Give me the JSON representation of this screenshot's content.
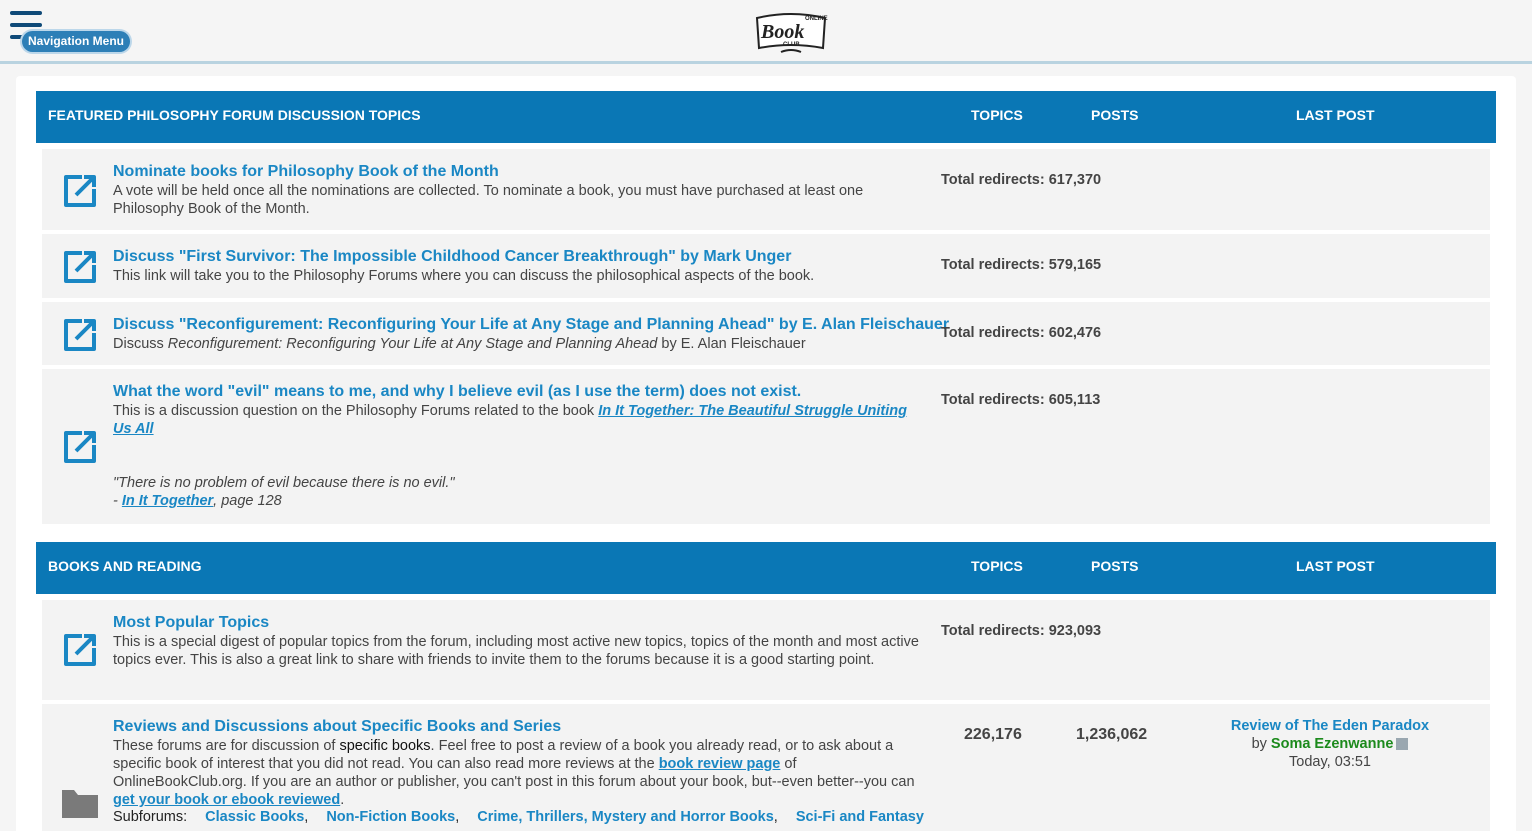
{
  "header": {
    "nav_menu_label": "Navigation Menu",
    "logo_text": {
      "top": "ONLINE",
      "main": "Book",
      "bottom": "CLUB"
    }
  },
  "sections": [
    {
      "title": "FEATURED PHILOSOPHY FORUM DISCUSSION TOPICS",
      "col_topics": "TOPICS",
      "col_posts": "POSTS",
      "col_last": "LAST POST",
      "rows": [
        {
          "title": "Nominate books for Philosophy Book of the Month",
          "desc": "A vote will be held once all the nominations are collected. To nominate a book, you must have purchased at least one Philosophy Book of the Month.",
          "redirects": "Total redirects: 617,370"
        },
        {
          "title": "Discuss \"First Survivor: The Impossible Childhood Cancer Breakthrough\" by Mark Unger",
          "desc": "This link will take you to the Philosophy Forums where you can discuss the philosophical aspects of the book.",
          "redirects": "Total redirects: 579,165"
        },
        {
          "title": "Discuss \"Reconfigurement: Reconfiguring Your Life at Any Stage and Planning Ahead\" by E. Alan Fleischauer",
          "desc_prefix": "Discuss ",
          "desc_italic": "Reconfigurement: Reconfiguring Your Life at Any Stage and Planning Ahead",
          "desc_suffix": " by E. Alan Fleischauer",
          "redirects": "Total redirects: 602,476"
        },
        {
          "title": "What the word \"evil\" means to me, and why I believe evil (as I use the term) does not exist.",
          "desc_prefix": "This is a discussion question on the Philosophy Forums related to the book ",
          "desc_link": "In It Together: The Beautiful Struggle Uniting Us All",
          "quote": "\"There is no problem of evil because there is no evil.\"",
          "quote_dash": "- ",
          "quote_link": "In It Together",
          "quote_page": ", page 128",
          "redirects": "Total redirects: 605,113"
        }
      ]
    },
    {
      "title": "BOOKS AND READING",
      "col_topics": "TOPICS",
      "col_posts": "POSTS",
      "col_last": "LAST POST",
      "rows": [
        {
          "title": "Most Popular Topics",
          "desc": "This is a special digest of popular topics from the forum, including most active new topics, topics of the month and most active topics ever. This is also a great link to share with friends to invite them to the forums because it is a good starting point.",
          "redirects": "Total redirects: 923,093"
        },
        {
          "title": "Reviews and Discussions about Specific Books and Series",
          "desc_a": "These forums are for discussion of ",
          "desc_b": "specific books",
          "desc_c": ". Feel free to post a review of a book you already read, or to ask about a specific book of interest that you did not read. You can also read more reviews at the ",
          "desc_link1": "book review page",
          "desc_d": " of OnlineBookClub.org. If you are an author or publisher, you can't post in this forum about your book, but--even better--you can ",
          "desc_link2": "get your book or ebook reviewed",
          "desc_e": ".",
          "topics": "226,176",
          "posts": "1,236,062",
          "last_post_title": "Review of The Eden Paradox",
          "last_post_by": "by ",
          "last_post_user": "Soma Ezenwanne",
          "last_post_time": "Today, 03:51",
          "subforums_label": "Subforums:",
          "subforums": [
            "Classic Books",
            "Non-Fiction Books",
            "Crime, Thrillers, Mystery and Horror Books",
            "Sci-Fi and Fantasy"
          ]
        }
      ]
    }
  ],
  "colors": {
    "header_blue": "#0a77b5",
    "link_blue": "#1a87c4",
    "username_green": "#1c8a1c",
    "nav_dark": "#0f4a78"
  },
  "icons": {
    "row_redirect": "external-link-icon",
    "row_forum": "folder-icon",
    "menu": "hamburger-icon"
  }
}
